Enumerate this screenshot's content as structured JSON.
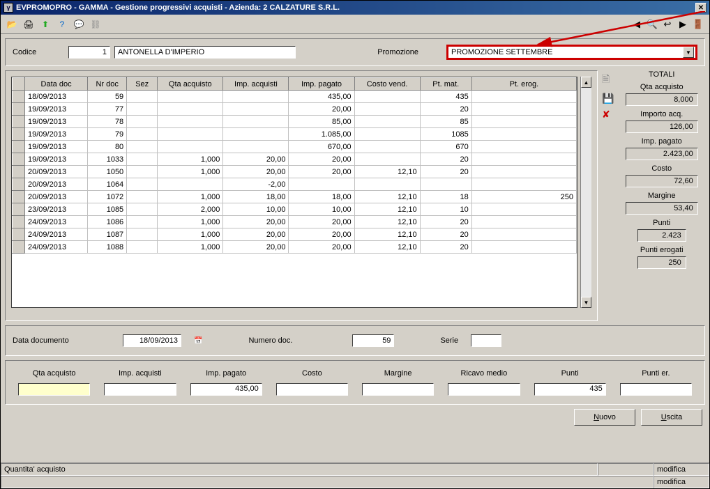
{
  "window": {
    "title": "EVPROMOPRO - GAMMA - Gestione progressivi acquisti - Azienda:   2 CALZATURE S.R.L."
  },
  "header": {
    "codice_label": "Codice",
    "codice_value": "1",
    "codice_desc": "ANTONELLA D'IMPERIO",
    "promozione_label": "Promozione",
    "promozione_value": "PROMOZIONE SETTEMBRE"
  },
  "grid": {
    "columns": [
      "Data doc",
      "Nr doc",
      "Sez",
      "Qta acquisto",
      "Imp. acquisti",
      "Imp. pagato",
      "Costo vend.",
      "Pt. mat.",
      "Pt. erog."
    ],
    "rows": [
      {
        "data": "18/09/2013",
        "nr": "59",
        "sez": "",
        "qta": "",
        "imp_acq": "",
        "imp_pag": "435,00",
        "costo": "",
        "ptmat": "435",
        "pterog": ""
      },
      {
        "data": "19/09/2013",
        "nr": "77",
        "sez": "",
        "qta": "",
        "imp_acq": "",
        "imp_pag": "20,00",
        "costo": "",
        "ptmat": "20",
        "pterog": ""
      },
      {
        "data": "19/09/2013",
        "nr": "78",
        "sez": "",
        "qta": "",
        "imp_acq": "",
        "imp_pag": "85,00",
        "costo": "",
        "ptmat": "85",
        "pterog": ""
      },
      {
        "data": "19/09/2013",
        "nr": "79",
        "sez": "",
        "qta": "",
        "imp_acq": "",
        "imp_pag": "1.085,00",
        "costo": "",
        "ptmat": "1085",
        "pterog": ""
      },
      {
        "data": "19/09/2013",
        "nr": "80",
        "sez": "",
        "qta": "",
        "imp_acq": "",
        "imp_pag": "670,00",
        "costo": "",
        "ptmat": "670",
        "pterog": ""
      },
      {
        "data": "19/09/2013",
        "nr": "1033",
        "sez": "",
        "qta": "1,000",
        "imp_acq": "20,00",
        "imp_pag": "20,00",
        "costo": "",
        "ptmat": "20",
        "pterog": ""
      },
      {
        "data": "20/09/2013",
        "nr": "1050",
        "sez": "",
        "qta": "1,000",
        "imp_acq": "20,00",
        "imp_pag": "20,00",
        "costo": "12,10",
        "ptmat": "20",
        "pterog": ""
      },
      {
        "data": "20/09/2013",
        "nr": "1064",
        "sez": "",
        "qta": "",
        "imp_acq": "-2,00",
        "imp_pag": "",
        "costo": "",
        "ptmat": "",
        "pterog": ""
      },
      {
        "data": "20/09/2013",
        "nr": "1072",
        "sez": "",
        "qta": "1,000",
        "imp_acq": "18,00",
        "imp_pag": "18,00",
        "costo": "12,10",
        "ptmat": "18",
        "pterog": "250"
      },
      {
        "data": "23/09/2013",
        "nr": "1085",
        "sez": "",
        "qta": "2,000",
        "imp_acq": "10,00",
        "imp_pag": "10,00",
        "costo": "12,10",
        "ptmat": "10",
        "pterog": ""
      },
      {
        "data": "24/09/2013",
        "nr": "1086",
        "sez": "",
        "qta": "1,000",
        "imp_acq": "20,00",
        "imp_pag": "20,00",
        "costo": "12,10",
        "ptmat": "20",
        "pterog": ""
      },
      {
        "data": "24/09/2013",
        "nr": "1087",
        "sez": "",
        "qta": "1,000",
        "imp_acq": "20,00",
        "imp_pag": "20,00",
        "costo": "12,10",
        "ptmat": "20",
        "pterog": ""
      },
      {
        "data": "24/09/2013",
        "nr": "1088",
        "sez": "",
        "qta": "1,000",
        "imp_acq": "20,00",
        "imp_pag": "20,00",
        "costo": "12,10",
        "ptmat": "20",
        "pterog": ""
      }
    ]
  },
  "totals": {
    "title": "TOTALI",
    "qta_label": "Qta acquisto",
    "qta": "8,000",
    "imp_acq_label": "Importo acq.",
    "imp_acq": "126,00",
    "imp_pag_label": "Imp. pagato",
    "imp_pag": "2.423,00",
    "costo_label": "Costo",
    "costo": "72,60",
    "margine_label": "Margine",
    "margine": "53,40",
    "punti_label": "Punti",
    "punti": "2.423",
    "punti_erog_label": "Punti erogati",
    "punti_erog": "250"
  },
  "detail": {
    "data_doc_label": "Data documento",
    "data_doc": "18/09/2013",
    "num_doc_label": "Numero doc.",
    "num_doc": "59",
    "serie_label": "Serie",
    "serie": ""
  },
  "inputs": {
    "labels": [
      "Qta acquisto",
      "Imp. acquisti",
      "Imp. pagato",
      "Costo",
      "Margine",
      "Ricavo medio",
      "Punti",
      "Punti er."
    ],
    "values": [
      "",
      "",
      "435,00",
      "",
      "",
      "",
      "435",
      ""
    ]
  },
  "buttons": {
    "nuovo": "Nuovo",
    "uscita": "Uscita"
  },
  "status": {
    "left": "Quantita' acquisto",
    "r1": "modifica",
    "r2": "modifica"
  }
}
